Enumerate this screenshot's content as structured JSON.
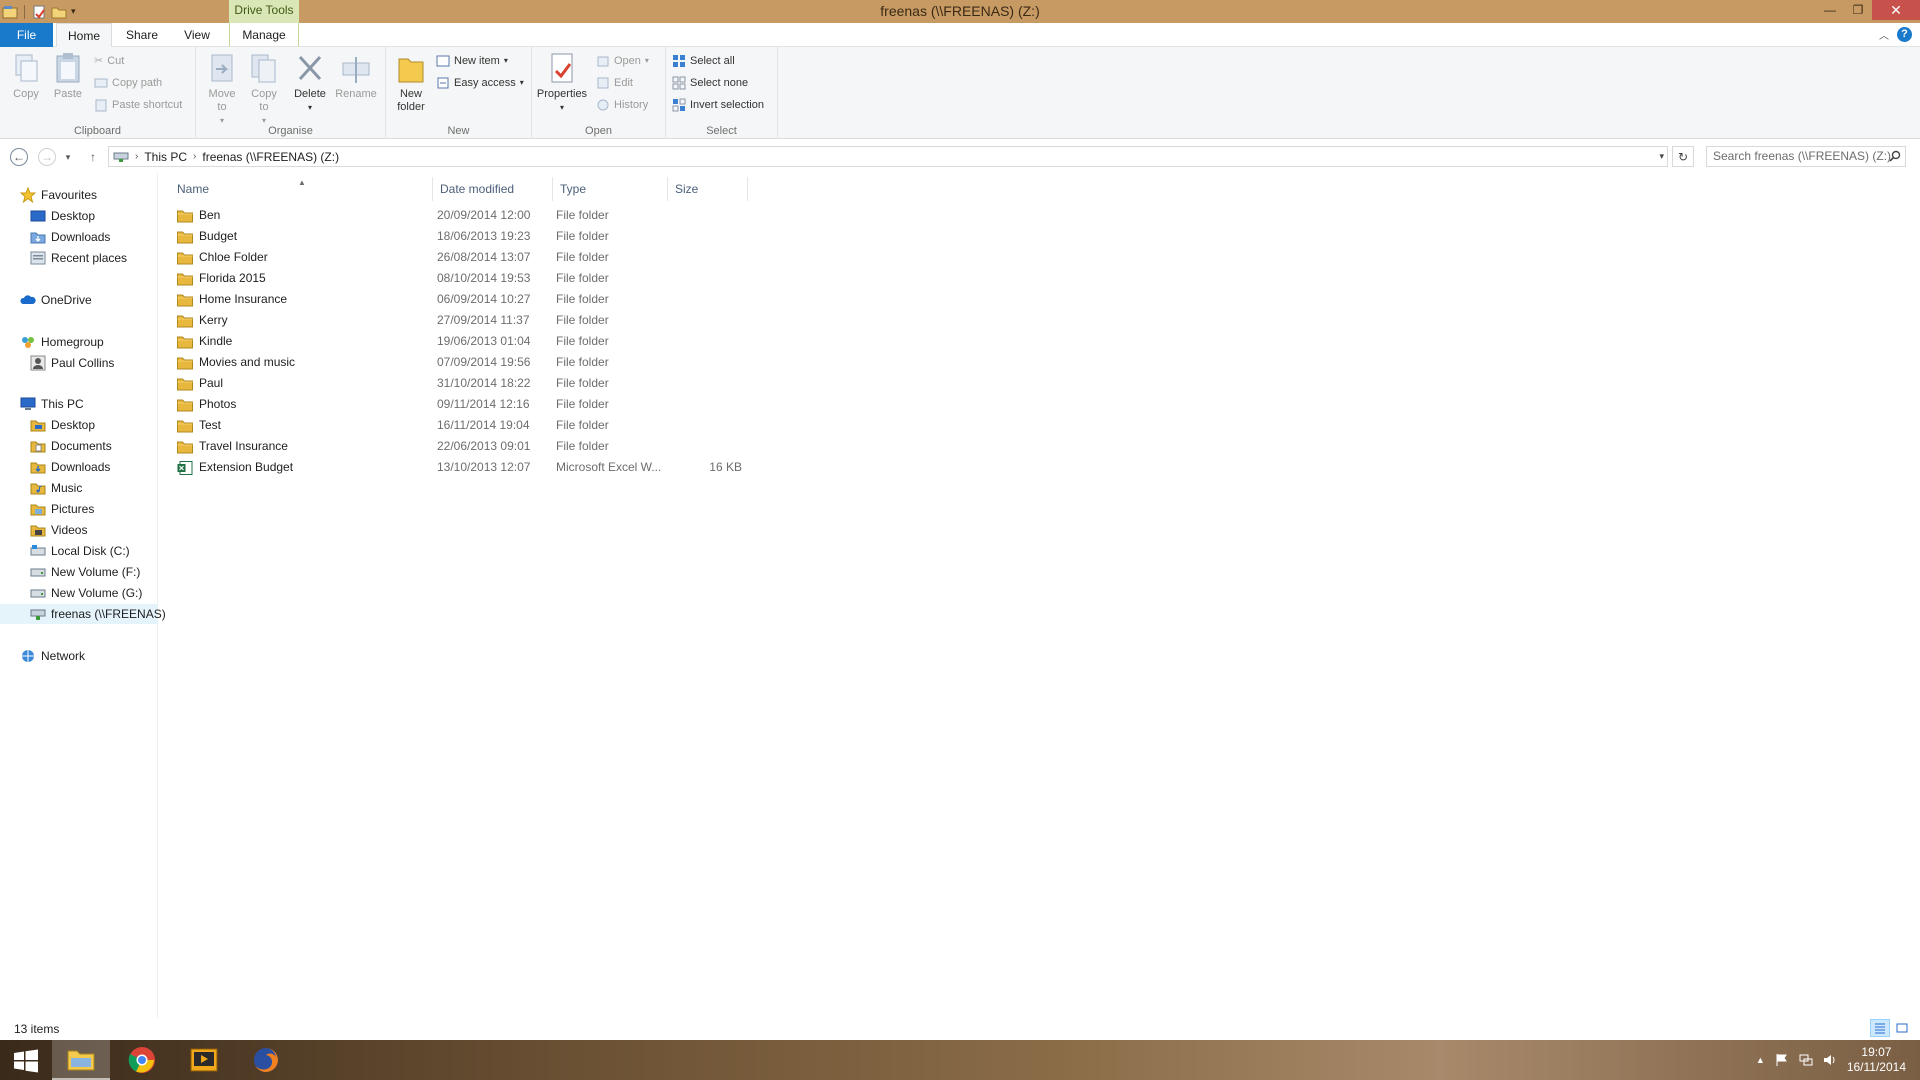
{
  "window": {
    "title": "freenas (\\\\FREENAS) (Z:)",
    "context_tab": "Drive Tools"
  },
  "ribbon_tabs": [
    "File",
    "Home",
    "Share",
    "View",
    "Manage"
  ],
  "ribbon": {
    "clipboard": {
      "label": "Clipboard",
      "copy": "Copy",
      "paste": "Paste",
      "cut": "Cut",
      "copy_path": "Copy path",
      "paste_shortcut": "Paste shortcut"
    },
    "organise": {
      "label": "Organise",
      "move_to": "Move to",
      "copy_to": "Copy to",
      "delete": "Delete",
      "rename": "Rename"
    },
    "new": {
      "label": "New",
      "new_folder": "New folder",
      "new_item": "New item",
      "easy_access": "Easy access"
    },
    "open": {
      "label": "Open",
      "properties": "Properties",
      "open": "Open",
      "edit": "Edit",
      "history": "History"
    },
    "select": {
      "label": "Select",
      "select_all": "Select all",
      "select_none": "Select none",
      "invert_selection": "Invert selection"
    }
  },
  "address": {
    "crumbs": [
      "This PC",
      "freenas (\\\\FREENAS) (Z:)"
    ],
    "search_placeholder": "Search freenas (\\\\FREENAS) (Z:)"
  },
  "nav": [
    {
      "label": "Favourites",
      "icon": "star-icon"
    },
    {
      "label": "Desktop",
      "icon": "desktop-icon"
    },
    {
      "label": "Downloads",
      "icon": "downloads-icon"
    },
    {
      "label": "Recent places",
      "icon": "recent-places-icon"
    },
    {
      "label": "OneDrive",
      "icon": "onedrive-icon"
    },
    {
      "label": "Homegroup",
      "icon": "homegroup-icon"
    },
    {
      "label": "Paul Collins",
      "icon": "user-icon"
    },
    {
      "label": "This PC",
      "icon": "computer-icon"
    },
    {
      "label": "Desktop",
      "icon": "desktop-icon"
    },
    {
      "label": "Documents",
      "icon": "documents-icon"
    },
    {
      "label": "Downloads",
      "icon": "downloads-icon"
    },
    {
      "label": "Music",
      "icon": "music-icon"
    },
    {
      "label": "Pictures",
      "icon": "pictures-icon"
    },
    {
      "label": "Videos",
      "icon": "videos-icon"
    },
    {
      "label": "Local Disk (C:)",
      "icon": "drive-icon"
    },
    {
      "label": "New Volume (F:)",
      "icon": "drive-icon"
    },
    {
      "label": "New Volume (G:)",
      "icon": "drive-icon"
    },
    {
      "label": "freenas (\\\\FREENAS)",
      "icon": "network-drive-icon"
    },
    {
      "label": "Network",
      "icon": "network-icon"
    }
  ],
  "columns": {
    "name": "Name",
    "date": "Date modified",
    "type": "Type",
    "size": "Size"
  },
  "files": [
    {
      "name": "Ben",
      "date": "20/09/2014 12:00",
      "type": "File folder",
      "size": ""
    },
    {
      "name": "Budget",
      "date": "18/06/2013 19:23",
      "type": "File folder",
      "size": ""
    },
    {
      "name": "Chloe Folder",
      "date": "26/08/2014 13:07",
      "type": "File folder",
      "size": ""
    },
    {
      "name": "Florida 2015",
      "date": "08/10/2014 19:53",
      "type": "File folder",
      "size": ""
    },
    {
      "name": "Home Insurance",
      "date": "06/09/2014 10:27",
      "type": "File folder",
      "size": ""
    },
    {
      "name": "Kerry",
      "date": "27/09/2014 11:37",
      "type": "File folder",
      "size": ""
    },
    {
      "name": "Kindle",
      "date": "19/06/2013 01:04",
      "type": "File folder",
      "size": ""
    },
    {
      "name": "Movies and music",
      "date": "07/09/2014 19:56",
      "type": "File folder",
      "size": ""
    },
    {
      "name": "Paul",
      "date": "31/10/2014 18:22",
      "type": "File folder",
      "size": ""
    },
    {
      "name": "Photos",
      "date": "09/11/2014 12:16",
      "type": "File folder",
      "size": ""
    },
    {
      "name": "Test",
      "date": "16/11/2014 19:04",
      "type": "File folder",
      "size": ""
    },
    {
      "name": "Travel Insurance",
      "date": "22/06/2013 09:01",
      "type": "File folder",
      "size": ""
    },
    {
      "name": "Extension Budget",
      "date": "13/10/2013 12:07",
      "type": "Microsoft Excel W...",
      "size": "16 KB"
    }
  ],
  "status": {
    "item_count": "13 items"
  },
  "taskbar": {
    "time": "19:07",
    "date": "16/11/2014"
  },
  "colors": {
    "accent": "#1979ca",
    "titlebar": "#c79a64",
    "close": "#c7524b",
    "folder": "#e8b73e"
  }
}
